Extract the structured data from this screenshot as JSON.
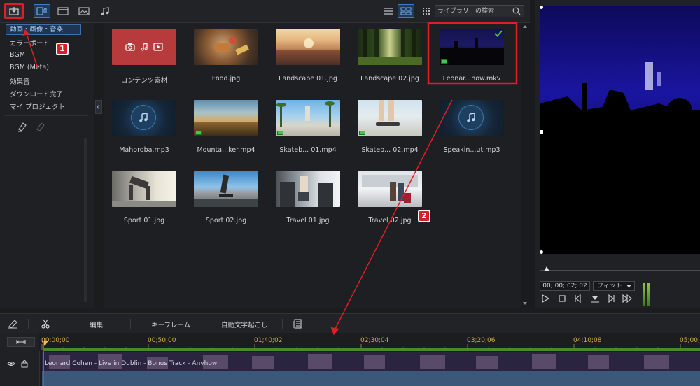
{
  "toolbar": {
    "search_placeholder": "ライブラリーの検索"
  },
  "sidebar": {
    "items": [
      {
        "label": "動画・画像・音楽",
        "selected": true
      },
      {
        "label": "カラーボード"
      },
      {
        "label": "BGM"
      },
      {
        "label": "BGM (Meta)"
      },
      {
        "label": "効果音"
      },
      {
        "label": "ダウンロード完了"
      },
      {
        "label": "マイ プロジェクト"
      }
    ]
  },
  "library": {
    "tiles": [
      {
        "label": "コンテンツ素材",
        "kind": "content"
      },
      {
        "label": "Food.jpg",
        "kind": "photo"
      },
      {
        "label": "Landscape 01.jpg",
        "kind": "photo"
      },
      {
        "label": "Landscape 02.jpg",
        "kind": "photo"
      },
      {
        "label": "Leonar...how.mkv",
        "kind": "video",
        "in_use": true
      },
      {
        "label": "Mahoroba.mp3",
        "kind": "audio"
      },
      {
        "label": "Mounta...ker.mp4",
        "kind": "video"
      },
      {
        "label": "Skateb... 01.mp4",
        "kind": "video"
      },
      {
        "label": "Skateb... 02.mp4",
        "kind": "video"
      },
      {
        "label": "Speakin...ut.mp3",
        "kind": "audio"
      },
      {
        "label": "Sport 01.jpg",
        "kind": "photo"
      },
      {
        "label": "Sport 02.jpg",
        "kind": "photo"
      },
      {
        "label": "Travel 01.jpg",
        "kind": "photo"
      },
      {
        "label": "Travel 02.jpg",
        "kind": "photo"
      }
    ]
  },
  "preview": {
    "timecode": "00; 00; 02; 02",
    "zoom": "フィット"
  },
  "edit_toolbar": {
    "edit": "編集",
    "keyframe": "キーフレーム",
    "auto_caption": "自動文字起こし"
  },
  "timeline": {
    "ticks": [
      "00;00;00",
      "00;50;00",
      "01;40;02",
      "02;30;04",
      "03;20;06",
      "04;10;08",
      "05;00;"
    ],
    "clip_label": "Leonard Cohen - Live in Dublin - Bonus Track - Anyhow"
  },
  "annotations": {
    "step1": "1",
    "step2": "2"
  },
  "colors": {
    "accent": "#3f7ad1",
    "annotation": "#e01e25",
    "check": "#4cc24e",
    "timecode": "#d7a84a"
  }
}
